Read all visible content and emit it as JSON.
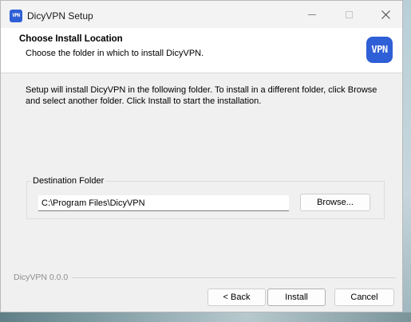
{
  "window": {
    "title": "DicyVPN Setup",
    "app_icon_text": "VPN"
  },
  "header": {
    "title": "Choose Install Location",
    "subtitle": "Choose the folder in which to install DicyVPN.",
    "logo_text": "VPN"
  },
  "body": {
    "intro": "Setup will install DicyVPN in the following folder. To install in a different folder, click Browse and select another folder. Click Install to start the installation."
  },
  "destination": {
    "group_label": "Destination Folder",
    "path_value": "C:\\Program Files\\DicyVPN",
    "browse_label": "Browse..."
  },
  "footer": {
    "brand": "DicyVPN 0.0.0",
    "back_label": "< Back",
    "install_label": "Install",
    "cancel_label": "Cancel"
  },
  "colors": {
    "accent": "#2f5fd6",
    "window_bg": "#f0f0f0",
    "header_bg": "#ffffff"
  },
  "icons": {
    "titlebar": [
      "minimize-icon",
      "maximize-icon",
      "close-icon"
    ]
  }
}
